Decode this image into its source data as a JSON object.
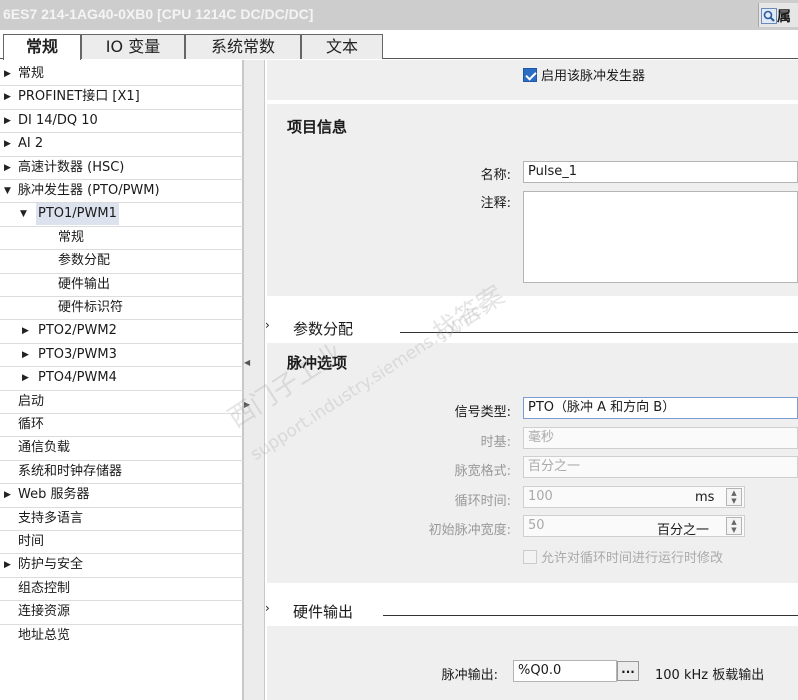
{
  "window": {
    "title": "6ES7 214-1AG40-0XB0 [CPU 1214C DC/DC/DC]",
    "props_button": "属"
  },
  "tabs": [
    {
      "label": "常规",
      "active": true
    },
    {
      "label": "IO 变量",
      "active": false
    },
    {
      "label": "系统常数",
      "active": false
    },
    {
      "label": "文本",
      "active": false
    }
  ],
  "sidebar": {
    "items": [
      {
        "label": "常规"
      },
      {
        "label": "PROFINET接口 [X1]"
      },
      {
        "label": "DI 14/DQ 10"
      },
      {
        "label": "AI 2"
      },
      {
        "label": "高速计数器 (HSC)"
      },
      {
        "label": "脉冲发生器 (PTO/PWM)"
      },
      {
        "label": "PTO1/PWM1"
      },
      {
        "label": "常规"
      },
      {
        "label": "参数分配"
      },
      {
        "label": "硬件输出"
      },
      {
        "label": "硬件标识符"
      },
      {
        "label": "PTO2/PWM2"
      },
      {
        "label": "PTO3/PWM3"
      },
      {
        "label": "PTO4/PWM4"
      },
      {
        "label": "启动"
      },
      {
        "label": "循环"
      },
      {
        "label": "通信负载"
      },
      {
        "label": "系统和时钟存储器"
      },
      {
        "label": "Web 服务器"
      },
      {
        "label": "支持多语言"
      },
      {
        "label": "时间"
      },
      {
        "label": "防护与安全"
      },
      {
        "label": "组态控制"
      },
      {
        "label": "连接资源"
      },
      {
        "label": "地址总览"
      }
    ]
  },
  "main": {
    "enable_label": "启用该脉冲发生器",
    "enable_checked": true,
    "project_info": {
      "title": "项目信息",
      "name_label": "名称:",
      "name_value": "Pulse_1",
      "comment_label": "注释:",
      "comment_value": ""
    },
    "param_section": "参数分配",
    "pulse_options": {
      "title": "脉冲选项",
      "signal_type_label": "信号类型:",
      "signal_type_value": "PTO（脉冲 A 和方向 B）",
      "time_base_label": "时基:",
      "time_base_value": "毫秒",
      "pulse_width_format_label": "脉宽格式:",
      "pulse_width_format_value": "百分之一",
      "cycle_time_label": "循环时间:",
      "cycle_time_value": "100",
      "cycle_time_unit": "ms",
      "initial_width_label": "初始脉冲宽度:",
      "initial_width_value": "50",
      "initial_width_unit": "百分之一",
      "runtime_mod_label": "允许对循环时间进行运行时修改",
      "runtime_mod_checked": false
    },
    "hw_output_section": "硬件输出",
    "hw_output": {
      "pulse_output_label": "脉冲输出:",
      "pulse_output_value": "%Q0.0",
      "browse_label": "...",
      "pulse_output_note": "100 kHz 板载输出"
    }
  },
  "watermark": {
    "line1": "西门子工业",
    "line2": "support.industry.siemens.com/cs",
    "line3": "找答案"
  }
}
